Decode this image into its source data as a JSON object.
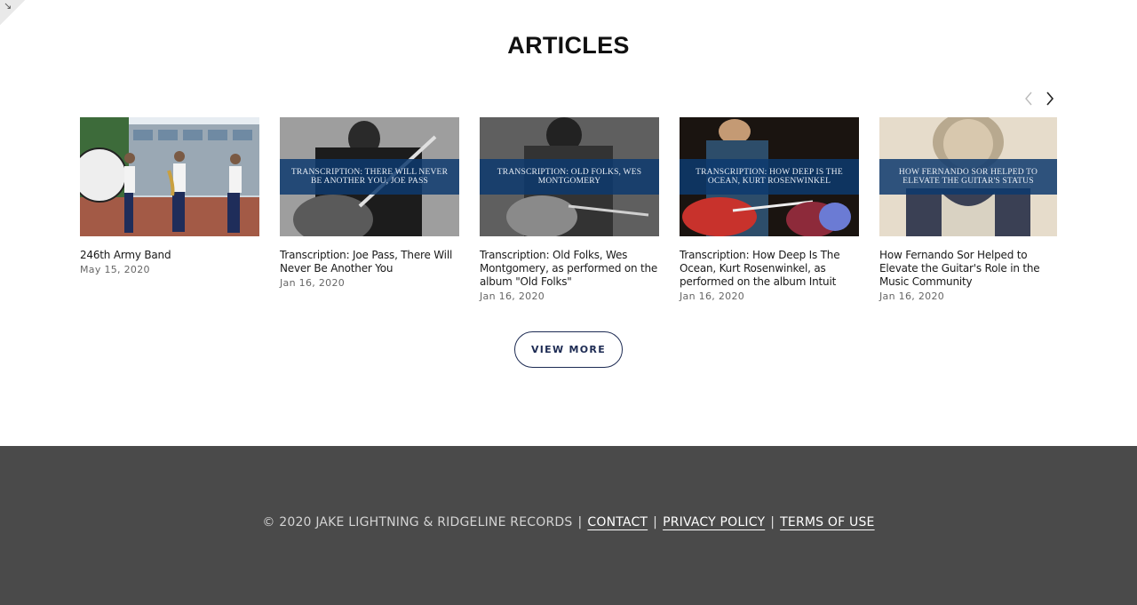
{
  "section": {
    "title": "ARTICLES"
  },
  "carousel": {
    "prev_icon": "chevron-left-icon",
    "next_icon": "chevron-right-icon"
  },
  "articles": [
    {
      "title": "246th Army Band",
      "date": "May 15, 2020",
      "banner": "",
      "image": "marching-band-photo"
    },
    {
      "title": "Transcription: Joe Pass, There Will Never Be Another You",
      "date": "Jan 16, 2020",
      "banner": "TRANSCRIPTION: THERE WILL NEVER BE ANOTHER YOU, JOE PASS",
      "image": "guitarist-bw-photo"
    },
    {
      "title": "Transcription: Old Folks, Wes Montgomery, as performed on the album \"Old Folks\"",
      "date": "Jan 16, 2020",
      "banner": "TRANSCRIPTION: OLD FOLKS, WES MONTGOMERY",
      "image": "guitarist-bw-photo"
    },
    {
      "title": "Transcription: How Deep Is The Ocean, Kurt Rosenwinkel, as performed on the album Intuit",
      "date": "Jan 16, 2020",
      "banner": "TRANSCRIPTION: HOW DEEP IS THE OCEAN, KURT ROSENWINKEL",
      "image": "guitarist-stage-photo"
    },
    {
      "title": "How Fernando Sor Helped to Elevate the Guitar's Role in the Music Community",
      "date": "Jan 16, 2020",
      "banner": "HOW FERNANDO SOR HELPED TO ELEVATE THE GUITAR'S STATUS",
      "image": "portrait-engraving"
    }
  ],
  "view_more_label": "VIEW MORE",
  "footer": {
    "copyright": "© 2020 JAKE LIGHTNING & RIDGELINE RECORDS",
    "separator": "|",
    "links": {
      "contact": "CONTACT",
      "privacy": "PRIVACY POLICY",
      "terms": "TERMS OF USE"
    }
  },
  "colors": {
    "footer_bg": "#4a4a4a",
    "button_border": "#1d2b53",
    "banner_bg": "#0d3a6e"
  }
}
